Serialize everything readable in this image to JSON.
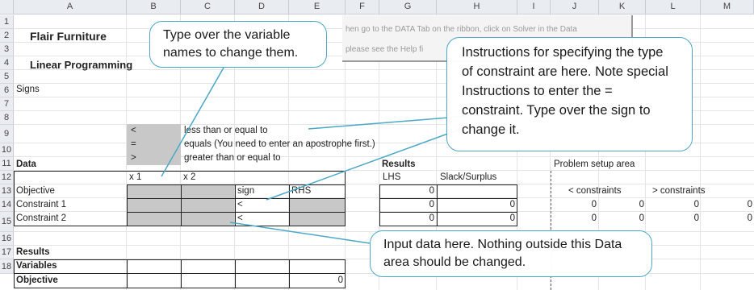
{
  "columns": [
    "A",
    "B",
    "C",
    "D",
    "E",
    "F",
    "G",
    "H",
    "I",
    "J",
    "K",
    "L",
    "M"
  ],
  "rows": [
    "1",
    "2",
    "3",
    "4",
    "5",
    "6",
    "7",
    "8",
    "9",
    "10",
    "11",
    "12",
    "13",
    "14",
    "15",
    "16",
    "17",
    "18"
  ],
  "sheet": {
    "title": "Flair Furniture",
    "subtitle": "Linear Programming",
    "signs_label": "Signs",
    "sign_lt": "<",
    "sign_eq": "=",
    "sign_gt": ">",
    "desc_lt": "less than or equal to",
    "desc_eq": "equals (You need to enter an apostrophe first.)",
    "desc_gt": "greater than or equal to",
    "data_label": "Data",
    "var1": "x 1",
    "var2": "x 2",
    "objective_label": "Objective",
    "sign_header": "sign",
    "rhs_header": "RHS",
    "constraint1_label": "Constraint 1",
    "constraint2_label": "Constraint 2",
    "constraint1_sign": "<",
    "constraint2_sign": "<",
    "results_label": "Results",
    "variables_label": "Variables",
    "objective_result_label": "Objective",
    "objective_result_value": "0",
    "results_panel_label": "Results",
    "lhs_header": "LHS",
    "slack_header": "Slack/Surplus",
    "lhs_values": [
      "0",
      "0",
      "0"
    ],
    "slack_values": [
      "0",
      "0"
    ],
    "setup_label": "Problem setup area",
    "lt_constraints": "< constraints",
    "gt_constraints": "> constraints",
    "setup_row13": [
      "0",
      "0",
      "0",
      "0"
    ],
    "setup_row14": [
      "0",
      "0",
      "0",
      "0"
    ],
    "faint_line1": "hen go to the DATA Tab on the ribbon, click on Solver in the Data",
    "faint_line2": "please see the Help fi"
  },
  "callouts": {
    "variable_names": "Type over the variable names to change them.",
    "constraint_type": "Instructions for specifying the type of constraint are here. Note special Instructions to enter the = constraint. Type over the sign to change it.",
    "input_data": "Input data here. Nothing outside this Data area should be changed."
  },
  "colors": {
    "callout_border": "#4aa8c8",
    "header_bg": "#e9ecf1",
    "shaded_cell": "#c8c8c8"
  }
}
